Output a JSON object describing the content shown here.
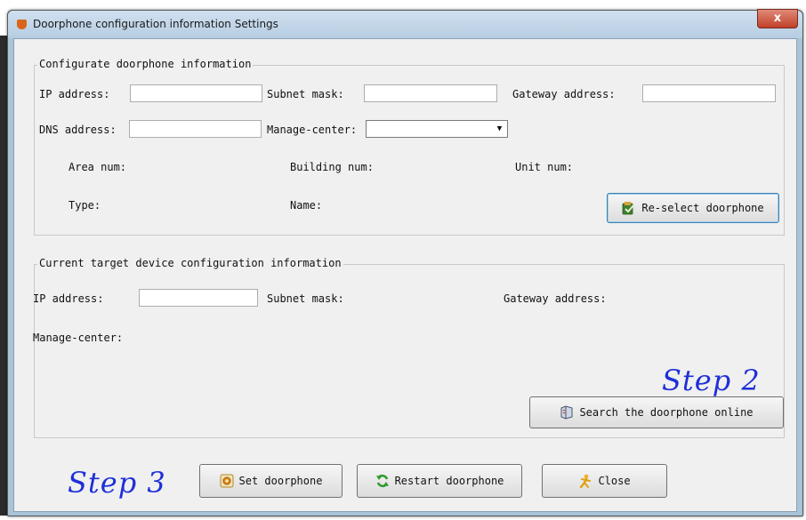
{
  "background_caption": "",
  "window": {
    "title": "Doorphone configuration information Settings",
    "close_symbol": "x"
  },
  "config_group": {
    "legend": "Configurate doorphone information",
    "ip_label": "IP address:",
    "ip_value": "",
    "subnet_label": "Subnet mask:",
    "subnet_value": "",
    "gateway_label": "Gateway address:",
    "gateway_value": "",
    "dns_label": "DNS address:",
    "dns_value": "",
    "manage_center_label": "Manage-center:",
    "manage_center_value": "",
    "area_label": "Area num:",
    "building_label": "Building num:",
    "unit_label": "Unit num:",
    "type_label": "Type:",
    "name_label": "Name:",
    "reselect_button": "Re-select doorphone",
    "reselect_icon": "device-check-icon"
  },
  "current_group": {
    "legend": "Current target device configuration information",
    "ip_label": "IP address:",
    "ip_value": "",
    "subnet_label": "Subnet mask:",
    "gateway_label": "Gateway address:",
    "manage_center_label": "Manage-center:",
    "step_label": "Step 2",
    "search_button": "Search the doorphone online",
    "search_icon": "search-device-icon"
  },
  "footer": {
    "step_label": "Step 3",
    "set_button": "Set doorphone",
    "set_icon": "settings-icon",
    "restart_button": "Restart doorphone",
    "restart_icon": "refresh-icon",
    "close_button": "Close",
    "close_icon": "person-exit-icon"
  },
  "colors": {
    "step_text": "#1f2fd8",
    "dialog_background": "#f0f0f0",
    "title_bar": "#b7cde2",
    "close_button": "#c0402a"
  }
}
